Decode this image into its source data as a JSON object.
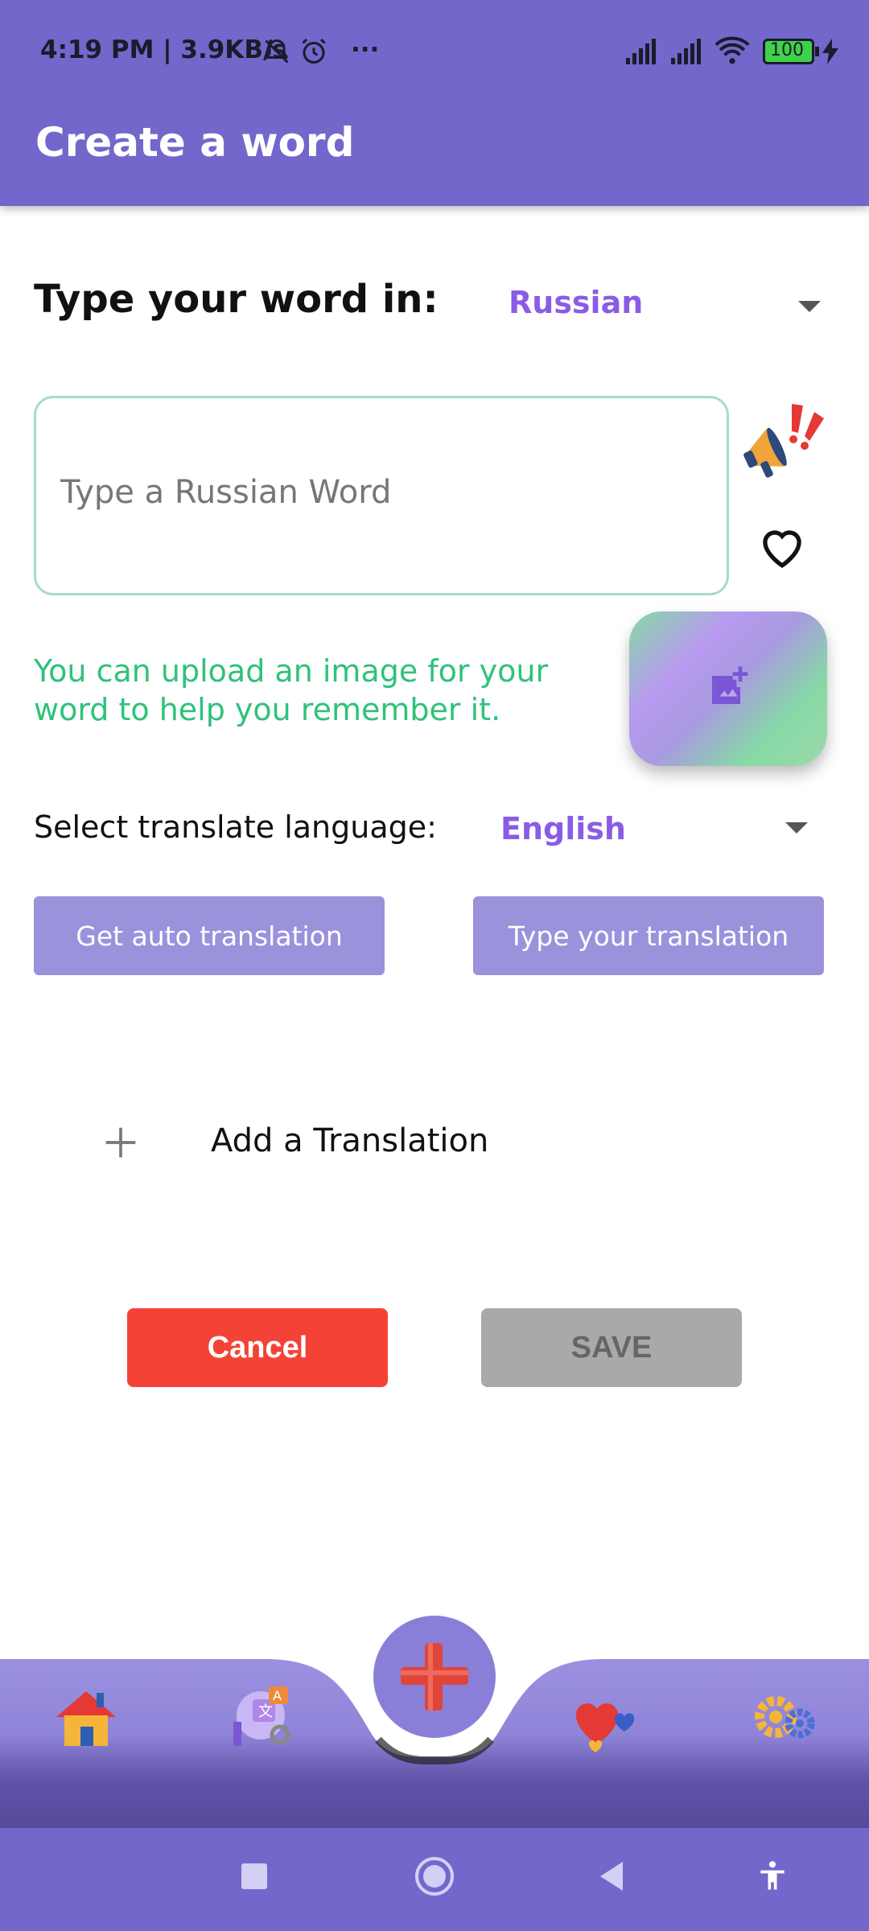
{
  "status_bar": {
    "left_text": "4:19 PM | 3.9KB/s",
    "more": "···",
    "battery": "100"
  },
  "app_bar": {
    "title": "Create a word"
  },
  "source": {
    "label": "Type your word in:",
    "language": "Russian",
    "input_placeholder": "Type a Russian Word",
    "input_value": ""
  },
  "image_hint": "You can upload an image for your word to help you remember it.",
  "target": {
    "label": "Select translate language:",
    "language": "English"
  },
  "buttons": {
    "auto_translation": "Get auto translation",
    "type_translation": "Type your translation",
    "add_translation": "Add a Translation",
    "cancel": "Cancel",
    "save": "SAVE"
  },
  "colors": {
    "primary": "#7367cc",
    "accent_text": "#8a5ce6",
    "hint_green": "#2fc27a",
    "cancel_red": "#f44336",
    "save_disabled": "#a9a9a9"
  },
  "bottom_nav": {
    "items": [
      "home-icon",
      "translate-icon",
      "add-word-fab-icon",
      "favorites-icon",
      "settings-icon"
    ]
  }
}
